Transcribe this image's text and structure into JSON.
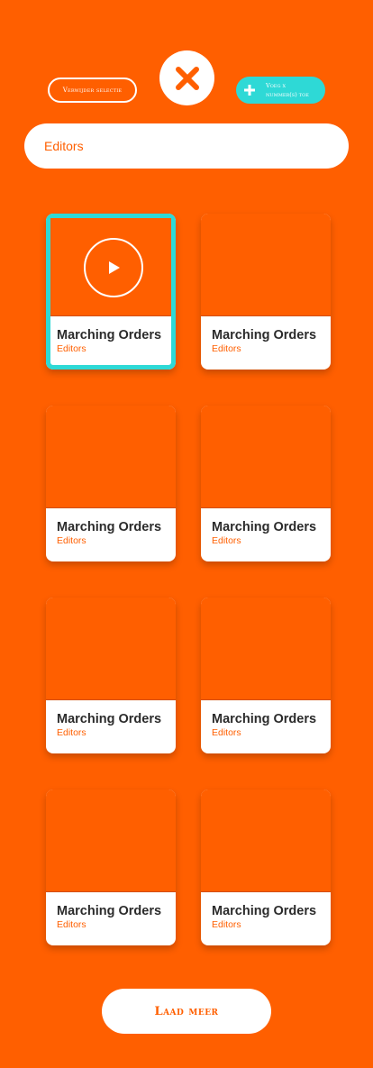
{
  "toolbar": {
    "remove_selection_label": "Verwijder selectie",
    "add_label_line1": "Voeg x",
    "add_label_line2": "nummer(s) toe",
    "close_icon": "close-x-icon",
    "add_icon": "plus-icon"
  },
  "search": {
    "value": "Editors"
  },
  "cards": [
    {
      "title": "Marching Orders",
      "artist": "Editors",
      "selected": true,
      "play_icon": "play-icon"
    },
    {
      "title": "Marching Orders",
      "artist": "Editors"
    },
    {
      "title": "Marching Orders",
      "artist": "Editors"
    },
    {
      "title": "Marching Orders",
      "artist": "Editors"
    },
    {
      "title": "Marching Orders",
      "artist": "Editors"
    },
    {
      "title": "Marching Orders",
      "artist": "Editors"
    },
    {
      "title": "Marching Orders",
      "artist": "Editors"
    },
    {
      "title": "Marching Orders",
      "artist": "Editors"
    }
  ],
  "load_more_label": "Laad meer",
  "colors": {
    "brand": "#FF5F00",
    "accent": "#2ED9D6",
    "white": "#FFFFFF",
    "text_dark": "#2B2B2B"
  }
}
